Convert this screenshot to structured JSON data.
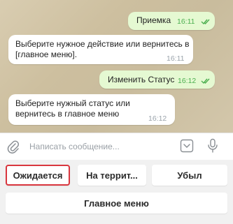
{
  "messages": [
    {
      "direction": "out",
      "text": "Приемка",
      "time": "16:11",
      "read": true
    },
    {
      "direction": "in",
      "text": "Выберите нужное действие или вернитесь в [главное меню].",
      "time": "16:11"
    },
    {
      "direction": "out",
      "text": "Изменить Статус",
      "time": "16:12",
      "read": true
    },
    {
      "direction": "in",
      "text": "Выберите нужный статус или вернитесь в главное меню",
      "time": "16:12"
    }
  ],
  "input": {
    "placeholder": "Написать сообщение..."
  },
  "keyboard": {
    "row1": [
      "Ожидается",
      "На террит...",
      "Убыл"
    ],
    "row2": [
      "Главное меню"
    ],
    "highlighted": "Ожидается"
  },
  "colors": {
    "outgoing": "#e5f9d2",
    "incoming": "#ffffff",
    "highlight": "#d9363e",
    "check": "#4caf50"
  }
}
